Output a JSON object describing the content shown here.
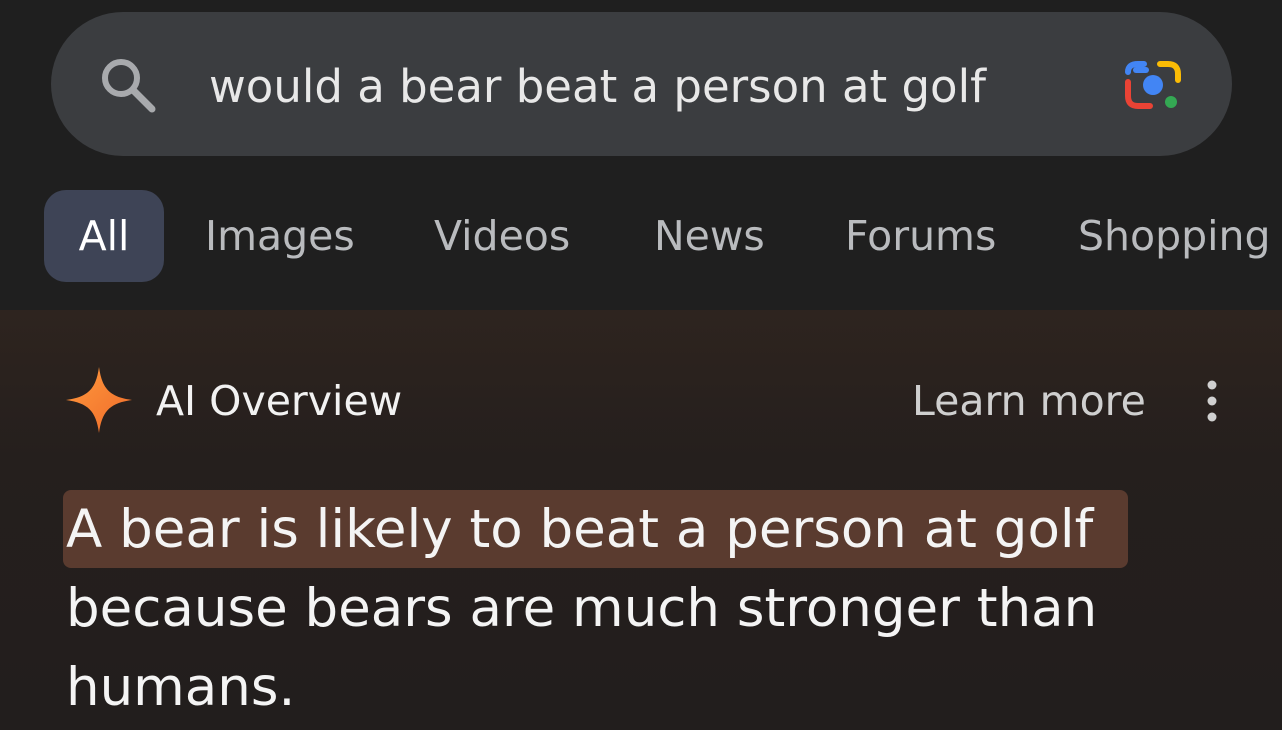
{
  "search": {
    "query": "would a bear beat a person at golf",
    "search_icon": "search-icon",
    "lens_icon": "google-lens-icon"
  },
  "tabs": [
    {
      "label": "All",
      "active": true
    },
    {
      "label": "Images"
    },
    {
      "label": "Videos"
    },
    {
      "label": "News"
    },
    {
      "label": "Forums"
    },
    {
      "label": "Shopping"
    }
  ],
  "ai_overview": {
    "icon": "sparkle-icon",
    "title": "AI Overview",
    "learn_more": "Learn more",
    "more_icon": "more-vert-icon",
    "highlight_text": "A bear is likely to beat a person at golf",
    "line_2": "because bears are much stronger than",
    "line_3": "humans."
  },
  "colors": {
    "background": "#1f1f1f",
    "search_bar": "#3b3d40",
    "tab_active": "#3e4456",
    "highlight": "#5a3b2f",
    "sparkle": "#f47c33"
  }
}
